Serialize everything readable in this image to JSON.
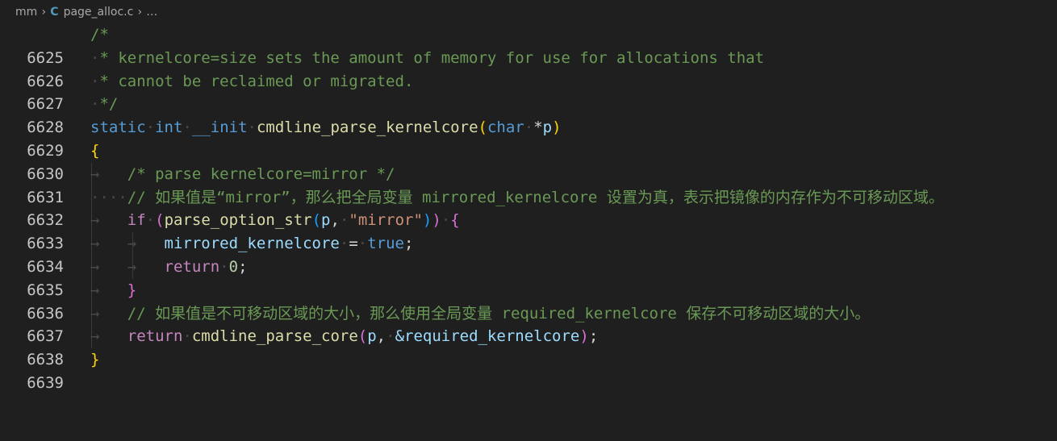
{
  "breadcrumb": {
    "folder": "mm",
    "file_icon": "C",
    "file": "page_alloc.c",
    "more": "…"
  },
  "lines": [
    {
      "n": "6625"
    },
    {
      "n": "6626"
    },
    {
      "n": "6627"
    },
    {
      "n": "6628"
    },
    {
      "n": "6629"
    },
    {
      "n": "6630"
    },
    {
      "n": "6631"
    },
    {
      "n": "6632"
    },
    {
      "n": "6633"
    },
    {
      "n": "6634"
    },
    {
      "n": "6635"
    },
    {
      "n": "6636"
    },
    {
      "n": "6637"
    },
    {
      "n": "6638"
    },
    {
      "n": "6639"
    }
  ],
  "code": {
    "l6625": "/*",
    "l6626": "* kernelcore=size sets the amount of memory for use for allocations that",
    "l6627": "* cannot be reclaimed or migrated.",
    "l6628": "*/",
    "l6629": {
      "static": "static",
      "int": "int",
      "init": "__init",
      "fn": "cmdline_parse_kernelcore",
      "lp": "(",
      "char": "char",
      "star": "*",
      "p": "p",
      "rp": ")"
    },
    "l6630": "{",
    "l6631": "/* parse kernelcore=mirror */",
    "l6632": "// 如果值是“mirror”，那么把全局变量 mirrored_kernelcore 设置为真，表示把镜像的内存作为不可移动区域。",
    "l6633": {
      "if": "if",
      "lp": "(",
      "fn": "parse_option_str",
      "lp2": "(",
      "p": "p",
      "comma": ",",
      "str": "\"mirror\"",
      "rp2": ")",
      "rp": ")",
      "brace": "{"
    },
    "l6634": {
      "var": "mirrored_kernelcore",
      "eq": "=",
      "val": "true",
      "semi": ";"
    },
    "l6635": {
      "ret": "return",
      "num": "0",
      "semi": ";"
    },
    "l6636": "}",
    "l6637": "// 如果值是不可移动区域的大小，那么使用全局变量 required_kernelcore 保存不可移动区域的大小。",
    "l6638": {
      "ret": "return",
      "fn": "cmdline_parse_core",
      "lp": "(",
      "p": "p",
      "comma": ",",
      "amp": "&required_kernelcore",
      "rp": ")",
      "semi": ";"
    },
    "l6639": "}"
  },
  "colors": {
    "background": "#1f1f1f",
    "comment": "#6a9955",
    "keyword": "#569cd6",
    "control": "#c586c0",
    "function": "#dcdcaa",
    "variable": "#9cdcfe",
    "string": "#ce9178",
    "number": "#b5cea8"
  }
}
